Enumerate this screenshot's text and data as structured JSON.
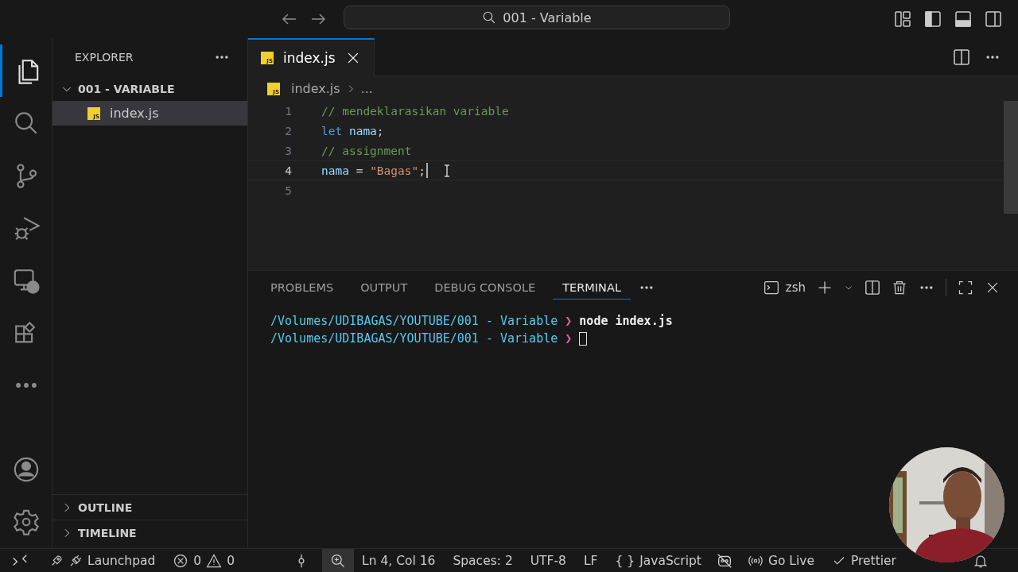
{
  "title_bar": {
    "search": "001 - Variable"
  },
  "activity_bar": [
    {
      "kind": "explorer",
      "selected": true
    },
    {
      "kind": "search",
      "selected": false
    },
    {
      "kind": "source-control",
      "selected": false
    },
    {
      "kind": "run-debug",
      "selected": false
    },
    {
      "kind": "remote",
      "selected": false
    },
    {
      "kind": "extensions",
      "selected": false
    },
    {
      "kind": "more",
      "selected": false
    }
  ],
  "activity_bar_bottom": [
    {
      "kind": "account"
    },
    {
      "kind": "settings"
    }
  ],
  "sidebar": {
    "title": "EXPLORER",
    "folder": {
      "name": "001 - VARIABLE",
      "expanded": true,
      "children": [
        {
          "name": "index.js",
          "badge": "JS",
          "selected": true
        }
      ]
    },
    "sections": [
      {
        "name": "OUTLINE",
        "expanded": false
      },
      {
        "name": "TIMELINE",
        "expanded": false
      }
    ]
  },
  "editor": {
    "tabs": [
      {
        "label": "index.js",
        "badge": "JS",
        "selected": true
      }
    ],
    "breadcrumb": {
      "badge": "JS",
      "file": "index.js",
      "rest": "..."
    },
    "lines": [
      {
        "number": "1",
        "current": false,
        "cursor": false,
        "tokens": [
          {
            "kind": "comment",
            "text": "// mendeklarasikan variable"
          }
        ]
      },
      {
        "number": "2",
        "current": false,
        "cursor": false,
        "tokens": [
          {
            "kind": "keyword",
            "text": "let"
          },
          {
            "kind": "variable",
            "text": "nama",
            "space_before": true
          },
          {
            "kind": "plain",
            "text": ";"
          }
        ]
      },
      {
        "number": "3",
        "current": false,
        "cursor": false,
        "tokens": [
          {
            "kind": "comment",
            "text": "// assignment"
          }
        ]
      },
      {
        "number": "4",
        "current": true,
        "cursor": true,
        "tokens": [
          {
            "kind": "variable",
            "text": "nama"
          },
          {
            "kind": "plain",
            "text": " = "
          },
          {
            "kind": "string",
            "text": "\"Bagas\""
          },
          {
            "kind": "plain",
            "text": ";"
          }
        ]
      },
      {
        "number": "5",
        "current": false,
        "cursor": false
      }
    ]
  },
  "panel": {
    "tabs": [
      {
        "label": "PROBLEMS",
        "selected": false
      },
      {
        "label": "OUTPUT",
        "selected": false
      },
      {
        "label": "DEBUG CONSOLE",
        "selected": false
      },
      {
        "label": "TERMINAL",
        "selected": true
      }
    ],
    "shell": "zsh",
    "terminal": [
      {
        "path": "/Volumes/UDIBAGAS/YOUTUBE/001 - Variable",
        "prompt": "❯",
        "command": "node index.js",
        "cursor": false
      },
      {
        "path": "/Volumes/UDIBAGAS/YOUTUBE/001 - Variable",
        "prompt": "❯",
        "cursor": true
      }
    ]
  },
  "status_bar": {
    "launchpad": "Launchpad",
    "errors": "0",
    "warnings": "0",
    "position": "Ln 4, Col 16",
    "indentation": "Spaces: 2",
    "encoding": "UTF-8",
    "eol": "LF",
    "language_braces": "{ }",
    "language": "JavaScript",
    "go_live": "Go Live",
    "prettier": "Prettier"
  }
}
